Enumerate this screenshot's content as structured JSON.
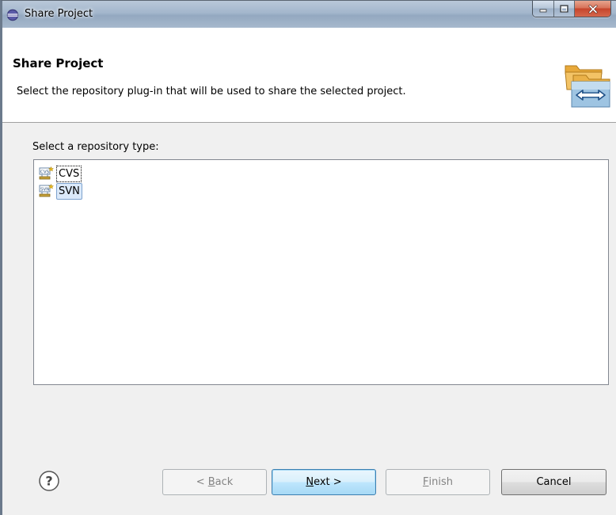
{
  "window": {
    "title": "Share Project"
  },
  "banner": {
    "title": "Share Project",
    "description": "Select the repository plug-in that will be used to share the selected project.",
    "icon": "folders-share-icon"
  },
  "repository_list": {
    "label": "Select a repository type:",
    "items": [
      {
        "label": "CVS",
        "icon": "cvs-repository-icon",
        "state": "focused"
      },
      {
        "label": "SVN",
        "icon": "svn-repository-icon",
        "state": "selected"
      }
    ]
  },
  "buttons": {
    "help_icon": "help-icon",
    "back": {
      "pre": "< ",
      "mnemonic": "B",
      "post": "ack",
      "enabled": false
    },
    "next": {
      "pre": "",
      "mnemonic": "N",
      "post": "ext >",
      "enabled": true
    },
    "finish": {
      "pre": "",
      "mnemonic": "F",
      "post": "inish",
      "enabled": false
    },
    "cancel": {
      "label": "Cancel",
      "enabled": true
    }
  },
  "colors": {
    "selection_bg": "#dbe9f9",
    "selection_border": "#7da2ce",
    "default_button_border": "#3c7fb1",
    "close_button": "#c6452c"
  }
}
